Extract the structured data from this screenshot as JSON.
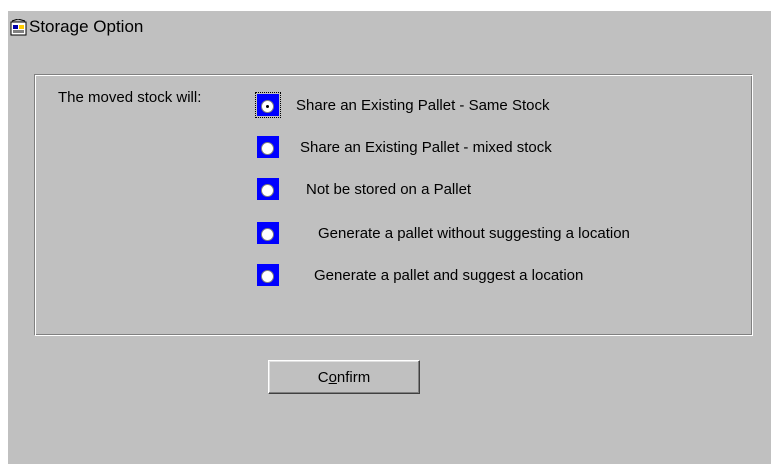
{
  "window": {
    "title": "Storage Option",
    "icon": "app-icon",
    "background": "#c0c0c0"
  },
  "storage": {
    "prompt": "The moved stock will:",
    "selected_index": 0,
    "options": [
      {
        "label": "Share an Existing Pallet - Same Stock",
        "selected": true
      },
      {
        "label": "Share an Existing Pallet - mixed stock",
        "selected": false
      },
      {
        "label": "Not be stored on a Pallet",
        "selected": false
      },
      {
        "label": "Generate a pallet without suggesting a location",
        "selected": false
      },
      {
        "label": "Generate a pallet and suggest a location",
        "selected": false
      }
    ],
    "radio_color": "#0000ff"
  },
  "actions": {
    "confirm_prefix": "C",
    "confirm_mnemonic": "o",
    "confirm_suffix": "nfirm"
  }
}
